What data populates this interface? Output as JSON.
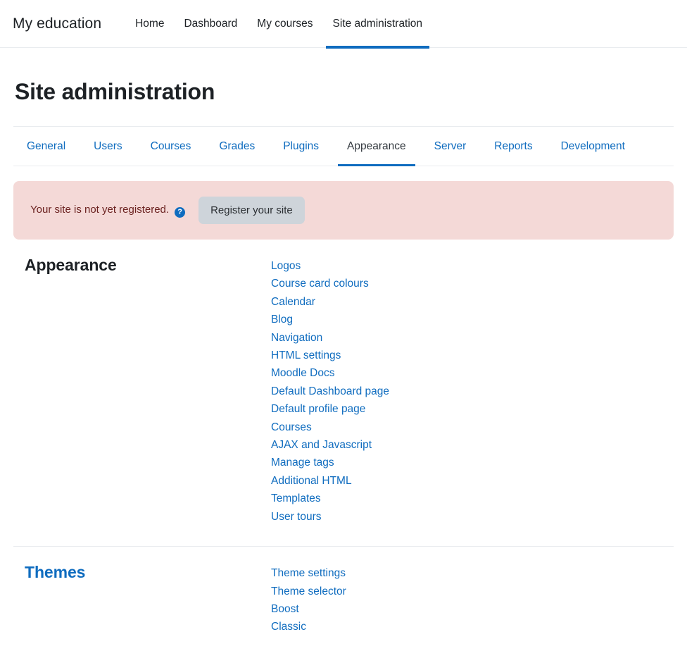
{
  "navbar": {
    "brand": "My education",
    "items": [
      {
        "label": "Home",
        "active": false
      },
      {
        "label": "Dashboard",
        "active": false
      },
      {
        "label": "My courses",
        "active": false
      },
      {
        "label": "Site administration",
        "active": true
      }
    ]
  },
  "page": {
    "title": "Site administration"
  },
  "tabs": [
    {
      "label": "General",
      "active": false
    },
    {
      "label": "Users",
      "active": false
    },
    {
      "label": "Courses",
      "active": false
    },
    {
      "label": "Grades",
      "active": false
    },
    {
      "label": "Plugins",
      "active": false
    },
    {
      "label": "Appearance",
      "active": true
    },
    {
      "label": "Server",
      "active": false
    },
    {
      "label": "Reports",
      "active": false
    },
    {
      "label": "Development",
      "active": false
    }
  ],
  "alert": {
    "message": "Your site is not yet registered.",
    "help_icon": "help-circle-icon",
    "help_glyph": "?",
    "button_label": "Register your site",
    "background_color": "#f4d9d7",
    "text_color": "#6b2220",
    "button_color": "#ced4da"
  },
  "sections": [
    {
      "heading": "Appearance",
      "heading_is_link": false,
      "links": [
        "Logos",
        "Course card colours",
        "Calendar",
        "Blog",
        "Navigation",
        "HTML settings",
        "Moodle Docs",
        "Default Dashboard page",
        "Default profile page",
        "Courses",
        "AJAX and Javascript",
        "Manage tags",
        "Additional HTML",
        "Templates",
        "User tours"
      ]
    },
    {
      "heading": "Themes",
      "heading_is_link": true,
      "links": [
        "Theme settings",
        "Theme selector",
        "Boost",
        "Classic"
      ]
    }
  ],
  "colors": {
    "link": "#0f6cbf",
    "accent": "#0f6cbf",
    "text": "#1d2125",
    "rule": "#e9ecef"
  }
}
